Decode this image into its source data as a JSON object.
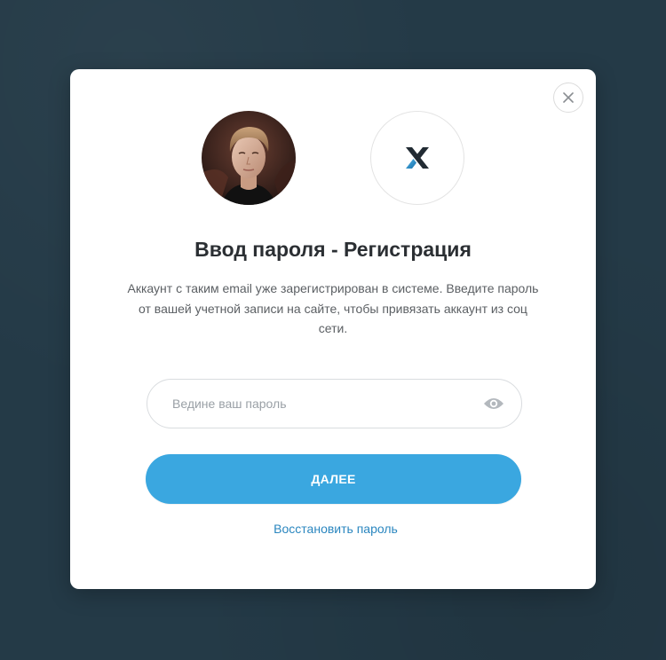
{
  "dialog": {
    "title": "Ввод пароля - Регистрация",
    "description": "Аккаунт с таким email уже зарегистрирован в системе. Введите пароль от вашей учетной записи на сайте,  чтобы привязать аккаунт из соц сети.",
    "close_icon": "close-icon",
    "user_avatar": "user-photo-avatar",
    "provider_logo": "x-logo-icon"
  },
  "password": {
    "placeholder": "Ведине ваш пароль",
    "value": "",
    "toggle_icon": "eye-icon"
  },
  "actions": {
    "submit_label": "ДАЛЕЕ",
    "restore_label": "Восстановить пароль"
  },
  "colors": {
    "backdrop": "#243a47",
    "accent": "#3aa7e0",
    "link": "#2a86bf",
    "title": "#2b2f33"
  }
}
